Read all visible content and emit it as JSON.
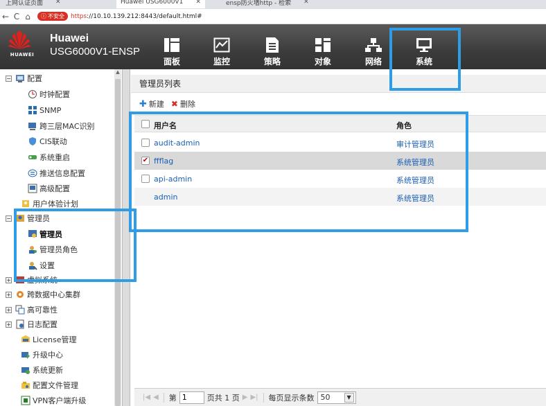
{
  "browser": {
    "tabs": [
      "上网认证页面",
      "Huawei USG6000V1",
      "ensp防火墙http - 检索"
    ],
    "insecure_label": "不安全",
    "url_scheme": "https",
    "url_rest": "://10.10.139.212:8443/default.html#"
  },
  "header": {
    "logo_text": "HUAWEI",
    "brand": "Huawei",
    "model": "USG6000V1-ENSP",
    "nav": [
      {
        "label": "面板",
        "icon": "dashboard-icon"
      },
      {
        "label": "监控",
        "icon": "monitor-icon"
      },
      {
        "label": "策略",
        "icon": "policy-icon"
      },
      {
        "label": "对象",
        "icon": "object-icon"
      },
      {
        "label": "网络",
        "icon": "network-icon"
      },
      {
        "label": "系统",
        "icon": "system-icon"
      }
    ]
  },
  "tree": {
    "config": "配置",
    "clock": "时钟配置",
    "snmp": "SNMP",
    "l3mac": "跨三层MAC识别",
    "cis": "CIS联动",
    "restart": "系统重启",
    "push": "推送信息配置",
    "advanced": "高级配置",
    "ux": "用户体验计划",
    "admin_group": "管理员",
    "admin": "管理员",
    "admin_role": "管理员角色",
    "settings": "设置",
    "vsys": "虚拟系统",
    "dc_cluster": "跨数据中心集群",
    "ha": "高可靠性",
    "log": "日志配置",
    "license": "License管理",
    "upgrade": "升级中心",
    "sysupdate": "系统更新",
    "cfgfile": "配置文件管理",
    "vpn": "VPN客户端升级"
  },
  "main": {
    "title": "管理员列表",
    "new": "新建",
    "delete": "删除",
    "col_user": "用户名",
    "col_role": "角色",
    "rows": [
      {
        "user": "audit-admin",
        "role": "审计管理员"
      },
      {
        "user": "ffflag",
        "role": "系统管理员"
      },
      {
        "user": "api-admin",
        "role": "系统管理员"
      },
      {
        "user": "admin",
        "role": "系统管理员"
      }
    ]
  },
  "pager": {
    "page_prefix": "第",
    "page_value": "1",
    "page_suffix": "页共 1 页",
    "per_page_label": "每页显示条数",
    "per_page_value": "50"
  }
}
